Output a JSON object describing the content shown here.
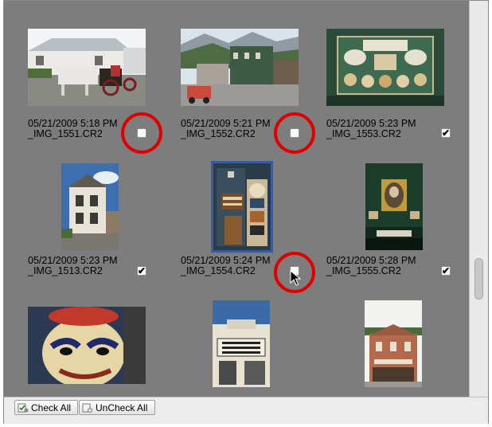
{
  "items": [
    {
      "date": "05/21/2009 5:18 PM",
      "file": "_IMG_1551.CR2",
      "checked": false,
      "highlighted": true,
      "selected": false
    },
    {
      "date": "05/21/2009 5:21 PM",
      "file": "_IMG_1552.CR2",
      "checked": false,
      "highlighted": true,
      "selected": false
    },
    {
      "date": "05/21/2009 5:23 PM",
      "file": "_IMG_1553.CR2",
      "checked": true,
      "highlighted": false,
      "selected": false
    },
    {
      "date": "05/21/2009 5:23 PM",
      "file": "_IMG_1513.CR2",
      "checked": true,
      "highlighted": false,
      "selected": false
    },
    {
      "date": "05/21/2009 5:24 PM",
      "file": "_IMG_1554.CR2",
      "checked": false,
      "highlighted": true,
      "selected": true
    },
    {
      "date": "05/21/2009 5:28 PM",
      "file": "_IMG_1555.CR2",
      "checked": true,
      "highlighted": false,
      "selected": false
    }
  ],
  "toolbar": {
    "check_all": "Check All",
    "uncheck_all": "UnCheck All"
  },
  "colors": {
    "grid_bg": "#7d7d7d",
    "highlight_ring": "#e00000",
    "selection": "#3a5a9a"
  }
}
